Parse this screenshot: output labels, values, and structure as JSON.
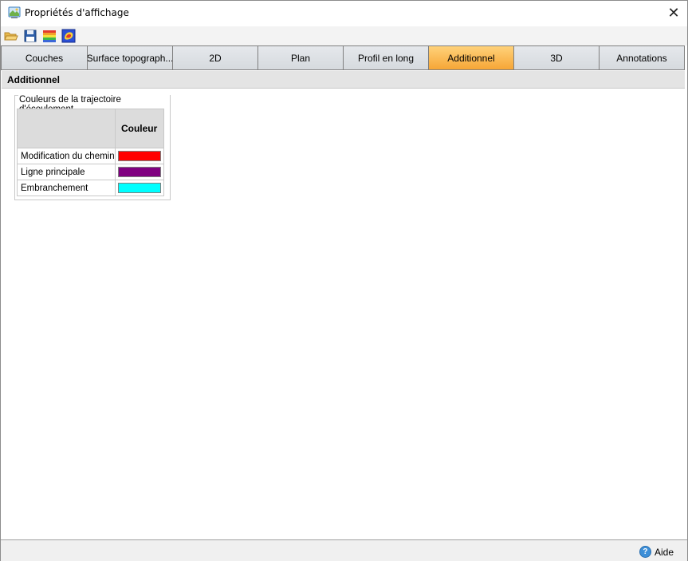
{
  "window": {
    "title": "Propriétés d'affichage",
    "close_glyph": "✕"
  },
  "toolbar": {
    "buttons": [
      {
        "name": "open-folder-icon"
      },
      {
        "name": "save-icon"
      },
      {
        "name": "color-palette-icon"
      },
      {
        "name": "color-map-icon"
      }
    ]
  },
  "tabs": [
    {
      "label": "Couches"
    },
    {
      "label": "Surface topograph..."
    },
    {
      "label": "2D"
    },
    {
      "label": "Plan"
    },
    {
      "label": "Profil en long"
    },
    {
      "label": "Additionnel",
      "active": true
    },
    {
      "label": "3D"
    },
    {
      "label": "Annotations"
    }
  ],
  "section": {
    "title": "Additionnel"
  },
  "group": {
    "title": "Couleurs de la trajectoire d'écoulement",
    "column_header": "Couleur",
    "rows": [
      {
        "label": "Modification du chemin",
        "color": "#ff0000"
      },
      {
        "label": "Ligne principale",
        "color": "#800080"
      },
      {
        "label": "Embranchement",
        "color": "#00ffff"
      }
    ]
  },
  "footer": {
    "help_label": "Aide",
    "help_icon": "?"
  }
}
